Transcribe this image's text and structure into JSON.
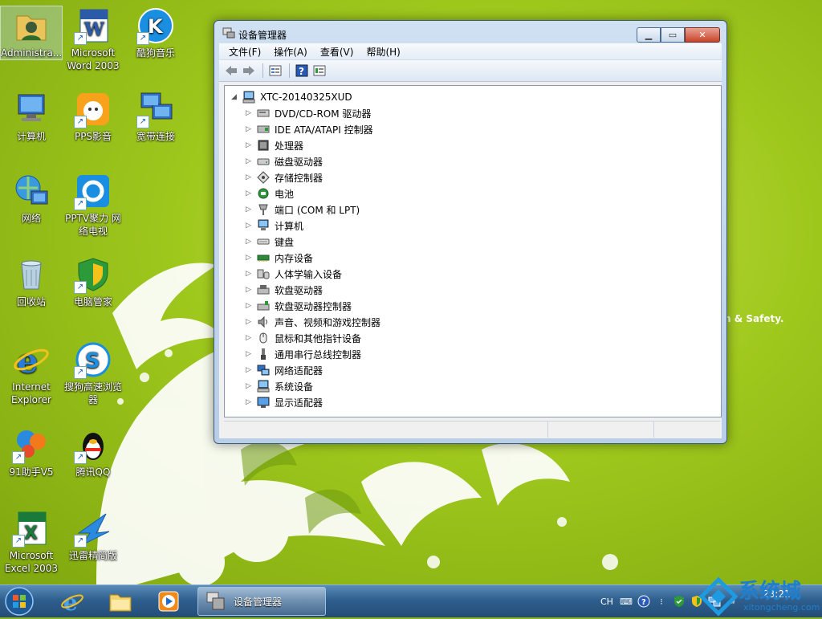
{
  "desktop": {
    "icons": [
      {
        "label": "Administra..."
      },
      {
        "label": "Microsoft Word 2003"
      },
      {
        "label": "酷狗音乐"
      },
      {
        "label": "计算机"
      },
      {
        "label": "PPS影音"
      },
      {
        "label": "宽带连接"
      },
      {
        "label": "网络"
      },
      {
        "label": "PPTV聚力 网络电视"
      },
      {
        "label": "回收站"
      },
      {
        "label": "电脑管家"
      },
      {
        "label": "Internet Explorer"
      },
      {
        "label": "搜狗高速浏览器"
      },
      {
        "label": "91助手V5"
      },
      {
        "label": "腾讯QQ"
      },
      {
        "label": "Microsoft Excel 2003"
      },
      {
        "label": "迅雷精简版"
      }
    ],
    "slogan": "n & Safety."
  },
  "window": {
    "title": "设备管理器",
    "menu": [
      "文件(F)",
      "操作(A)",
      "查看(V)",
      "帮助(H)"
    ],
    "root": "XTC-20140325XUD",
    "categories": [
      {
        "label": "DVD/CD-ROM 驱动器",
        "icon": "optical-drive-icon"
      },
      {
        "label": "IDE ATA/ATAPI 控制器",
        "icon": "ide-controller-icon"
      },
      {
        "label": "处理器",
        "icon": "processor-icon"
      },
      {
        "label": "磁盘驱动器",
        "icon": "disk-drive-icon"
      },
      {
        "label": "存储控制器",
        "icon": "storage-controller-icon"
      },
      {
        "label": "电池",
        "icon": "battery-icon"
      },
      {
        "label": "端口 (COM 和 LPT)",
        "icon": "port-icon"
      },
      {
        "label": "计算机",
        "icon": "computer-icon"
      },
      {
        "label": "键盘",
        "icon": "keyboard-icon"
      },
      {
        "label": "内存设备",
        "icon": "memory-icon"
      },
      {
        "label": "人体学输入设备",
        "icon": "hid-icon"
      },
      {
        "label": "软盘驱动器",
        "icon": "floppy-drive-icon"
      },
      {
        "label": "软盘驱动器控制器",
        "icon": "floppy-controller-icon"
      },
      {
        "label": "声音、视频和游戏控制器",
        "icon": "sound-icon"
      },
      {
        "label": "鼠标和其他指针设备",
        "icon": "mouse-icon"
      },
      {
        "label": "通用串行总线控制器",
        "icon": "usb-icon"
      },
      {
        "label": "网络适配器",
        "icon": "network-adapter-icon"
      },
      {
        "label": "系统设备",
        "icon": "system-device-icon"
      },
      {
        "label": "显示适配器",
        "icon": "display-adapter-icon"
      }
    ]
  },
  "taskbar": {
    "task_label": "设备管理器",
    "language": "CH",
    "clock": "23:21"
  },
  "watermark": {
    "title": "系统城",
    "url": "xitongcheng.com"
  }
}
